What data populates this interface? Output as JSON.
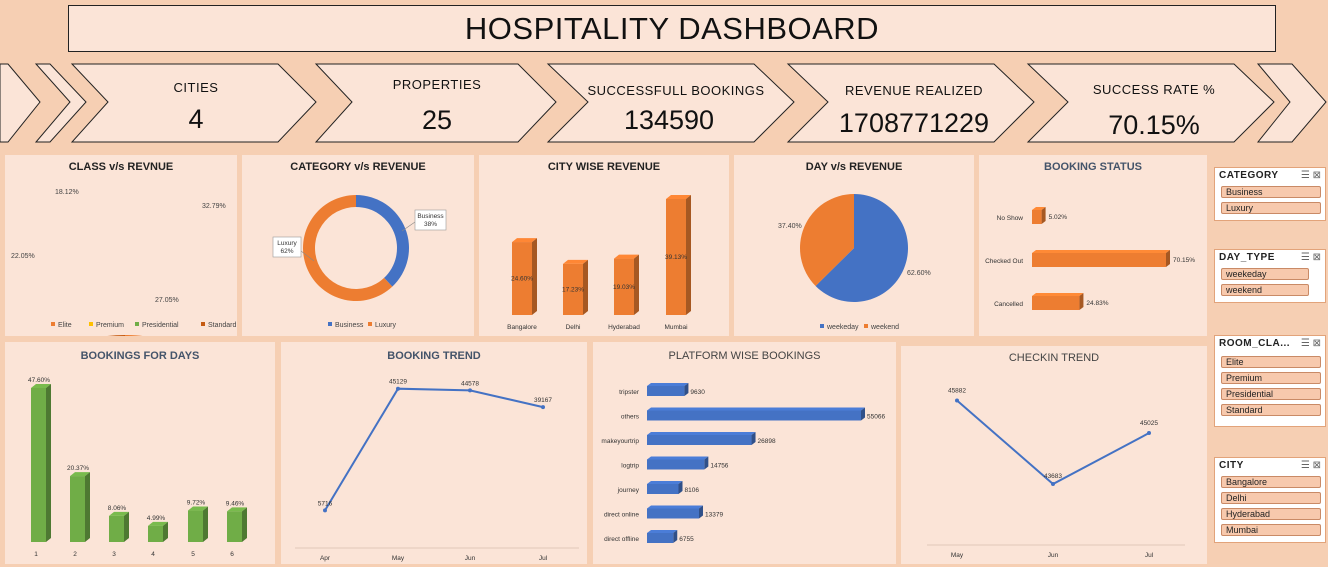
{
  "title": "HOSPITALITY DASHBOARD",
  "kpis": [
    {
      "label": "CITIES",
      "value": "4"
    },
    {
      "label": "PROPERTIES",
      "value": "25"
    },
    {
      "label": "SUCCESSFULL BOOKINGS",
      "value": "134590"
    },
    {
      "label": "REVENUE REALIZED",
      "value": "1708771229"
    },
    {
      "label": "SUCCESS RATE %",
      "value": "70.15%"
    }
  ],
  "colors": {
    "orange": "#ed7d31",
    "blue": "#4472c4",
    "green": "#70ad47",
    "yellow": "#ffc000",
    "darkorange": "#c55a11",
    "panel": "#fbe4d7",
    "bg": "#f6cfb3"
  },
  "chart_data": [
    {
      "id": "class_revenue",
      "type": "pie",
      "title": "CLASS v/s REVNUE",
      "categories": [
        "Elite",
        "Premium",
        "Presidential",
        "Standard"
      ],
      "values": [
        32.79,
        27.05,
        22.05,
        18.12
      ],
      "labels": [
        "32.79%",
        "27.05%",
        "22.05%",
        "18.12%"
      ],
      "colors": [
        "#ed7d31",
        "#ffc000",
        "#70ad47",
        "#c55a11"
      ],
      "legend": "bottom"
    },
    {
      "id": "category_revenue",
      "type": "pie",
      "title": "CATEGORY v/s REVENUE",
      "categories": [
        "Business",
        "Luxury"
      ],
      "values": [
        38,
        62
      ],
      "callouts": [
        {
          "name": "Business",
          "pct": "38%"
        },
        {
          "name": "Luxury",
          "pct": "62%"
        }
      ],
      "colors": [
        "#4472c4",
        "#ed7d31"
      ],
      "legend": "bottom"
    },
    {
      "id": "city_revenue",
      "type": "bar",
      "title": "CITY WISE REVENUE",
      "categories": [
        "Bangalore",
        "Delhi",
        "Hyderabad",
        "Mumbai"
      ],
      "values": [
        24.6,
        17.23,
        19.03,
        39.13
      ],
      "labels": [
        "24.60%",
        "17.23%",
        "19.03%",
        "39.13%"
      ],
      "color": "#ed7d31"
    },
    {
      "id": "day_revenue",
      "type": "pie",
      "title": "DAY v/s REVENUE",
      "categories": [
        "weekeday",
        "weekend"
      ],
      "values": [
        62.6,
        37.4
      ],
      "labels": [
        "62.60%",
        "37.40%"
      ],
      "colors": [
        "#4472c4",
        "#ed7d31"
      ],
      "legend": "bottom"
    },
    {
      "id": "booking_status",
      "type": "bar",
      "orientation": "horizontal",
      "title": "BOOKING STATUS",
      "categories": [
        "No Show",
        "Checked Out",
        "Cancelled"
      ],
      "values": [
        5.02,
        70.15,
        24.83
      ],
      "labels": [
        "5.02%",
        "70.15%",
        "24.83%"
      ],
      "color": "#ed7d31"
    },
    {
      "id": "bookings_days",
      "type": "bar",
      "title": "BOOKINGS FOR DAYS",
      "categories": [
        "1",
        "2",
        "3",
        "4",
        "5",
        "6"
      ],
      "values": [
        47.6,
        20.37,
        8.06,
        4.99,
        9.72,
        9.46
      ],
      "labels": [
        "47.60%",
        "20.37%",
        "8.06%",
        "4.99%",
        "9.72%",
        "9.46%"
      ],
      "color": "#70ad47"
    },
    {
      "id": "booking_trend",
      "type": "line",
      "title": "BOOKING TREND",
      "categories": [
        "Apr",
        "May",
        "Jun",
        "Jul"
      ],
      "values": [
        5716,
        45129,
        44578,
        39167
      ],
      "labels": [
        "5716",
        "45129",
        "44578",
        "39167"
      ],
      "color": "#4472c4"
    },
    {
      "id": "platform_bookings",
      "type": "bar",
      "orientation": "horizontal",
      "title": "PLATFORM WISE BOOKINGS",
      "categories": [
        "tripster",
        "others",
        "makeyourtrip",
        "logtrip",
        "journey",
        "direct online",
        "direct offline"
      ],
      "values": [
        9630,
        55066,
        26898,
        14756,
        8106,
        13379,
        6755
      ],
      "labels": [
        "9630",
        "55066",
        "26898",
        "14756",
        "8106",
        "13379",
        "6755"
      ],
      "color": "#4472c4"
    },
    {
      "id": "checkin_trend",
      "type": "line",
      "title": "CHECKIN TREND",
      "categories": [
        "May",
        "Jun",
        "Jul"
      ],
      "values": [
        45882,
        43683,
        45025
      ],
      "labels": [
        "45882",
        "43683",
        "45025"
      ],
      "color": "#4472c4"
    }
  ],
  "slicers": [
    {
      "header": "CATEGORY",
      "items": [
        "Business",
        "Luxury"
      ]
    },
    {
      "header": "DAY_TYPE",
      "items": [
        "weekeday",
        "weekend"
      ]
    },
    {
      "header": "ROOM_CLA...",
      "items": [
        "Elite",
        "Premium",
        "Presidential",
        "Standard"
      ]
    },
    {
      "header": "CITY",
      "items": [
        "Bangalore",
        "Delhi",
        "Hyderabad",
        "Mumbai"
      ]
    }
  ]
}
